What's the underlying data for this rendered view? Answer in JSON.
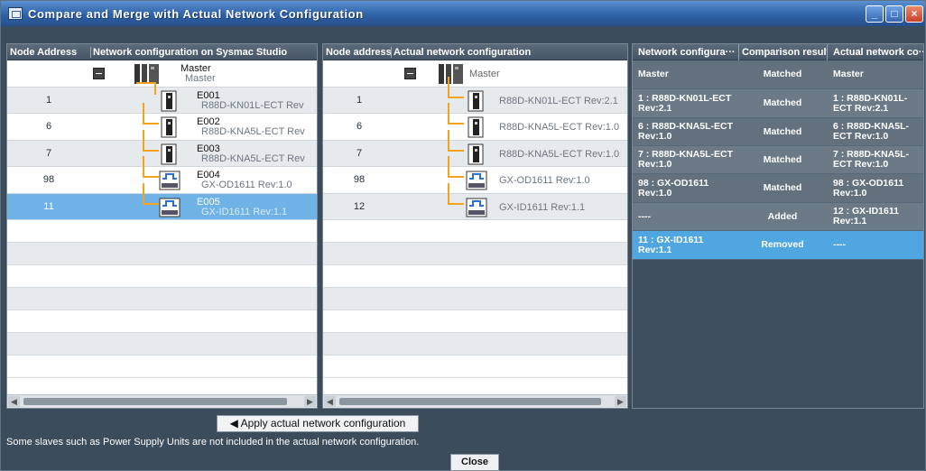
{
  "window": {
    "title": "Compare and Merge with Actual Network Configuration"
  },
  "sysmac_panel": {
    "header_addr": "Node Address",
    "header_config": "Network configuration on Sysmac Studio",
    "master_name": "Master",
    "master_model": "Master",
    "rows": [
      {
        "addr": "1",
        "name": "E001",
        "model": "R88D-KN01L-ECT Rev"
      },
      {
        "addr": "6",
        "name": "E002",
        "model": "R88D-KNA5L-ECT Rev"
      },
      {
        "addr": "7",
        "name": "E003",
        "model": "R88D-KNA5L-ECT Rev"
      },
      {
        "addr": "98",
        "name": "E004",
        "model": "GX-OD1611 Rev:1.0"
      },
      {
        "addr": "11",
        "name": "E005",
        "model": "GX-ID1611 Rev:1.1"
      }
    ]
  },
  "actual_panel": {
    "header_addr": "Node address",
    "header_config": "Actual network configuration",
    "master_name": "Master",
    "rows": [
      {
        "addr": "1",
        "model": "R88D-KN01L-ECT Rev:2.1"
      },
      {
        "addr": "6",
        "model": "R88D-KNA5L-ECT Rev:1.0"
      },
      {
        "addr": "7",
        "model": "R88D-KNA5L-ECT Rev:1.0"
      },
      {
        "addr": "98",
        "model": "GX-OD1611 Rev:1.0"
      },
      {
        "addr": "12",
        "model": "GX-ID1611 Rev:1.1"
      }
    ]
  },
  "comparison": {
    "col1": "Network configura···",
    "col2": "Comparison result",
    "col3": "Actual network co···",
    "rows": [
      {
        "a": "Master",
        "r": "Matched",
        "b": "Master"
      },
      {
        "a": "1 : R88D-KN01L-ECT Rev:2.1",
        "r": "Matched",
        "b": "1 : R88D-KN01L-ECT Rev:2.1"
      },
      {
        "a": "6 : R88D-KNA5L-ECT Rev:1.0",
        "r": "Matched",
        "b": "6 : R88D-KNA5L-ECT Rev:1.0"
      },
      {
        "a": "7 : R88D-KNA5L-ECT Rev:1.0",
        "r": "Matched",
        "b": "7 : R88D-KNA5L-ECT Rev:1.0"
      },
      {
        "a": "98 : GX-OD1611 Rev:1.0",
        "r": "Matched",
        "b": "98 : GX-OD1611 Rev:1.0"
      },
      {
        "a": "----",
        "r": "Added",
        "b": "12 : GX-ID1611 Rev:1.1"
      },
      {
        "a": "11 : GX-ID1611 Rev:1.1",
        "r": "Removed",
        "b": "----"
      }
    ]
  },
  "footer": {
    "apply_label": "Apply actual network configuration",
    "note": "Some slaves such as Power Supply Units are not included in the actual network configuration.",
    "close_label": "Close"
  },
  "colors": {
    "wire": "#f5a31c",
    "selected": "#6fb2e6",
    "titlebar": "#2f62a8"
  }
}
